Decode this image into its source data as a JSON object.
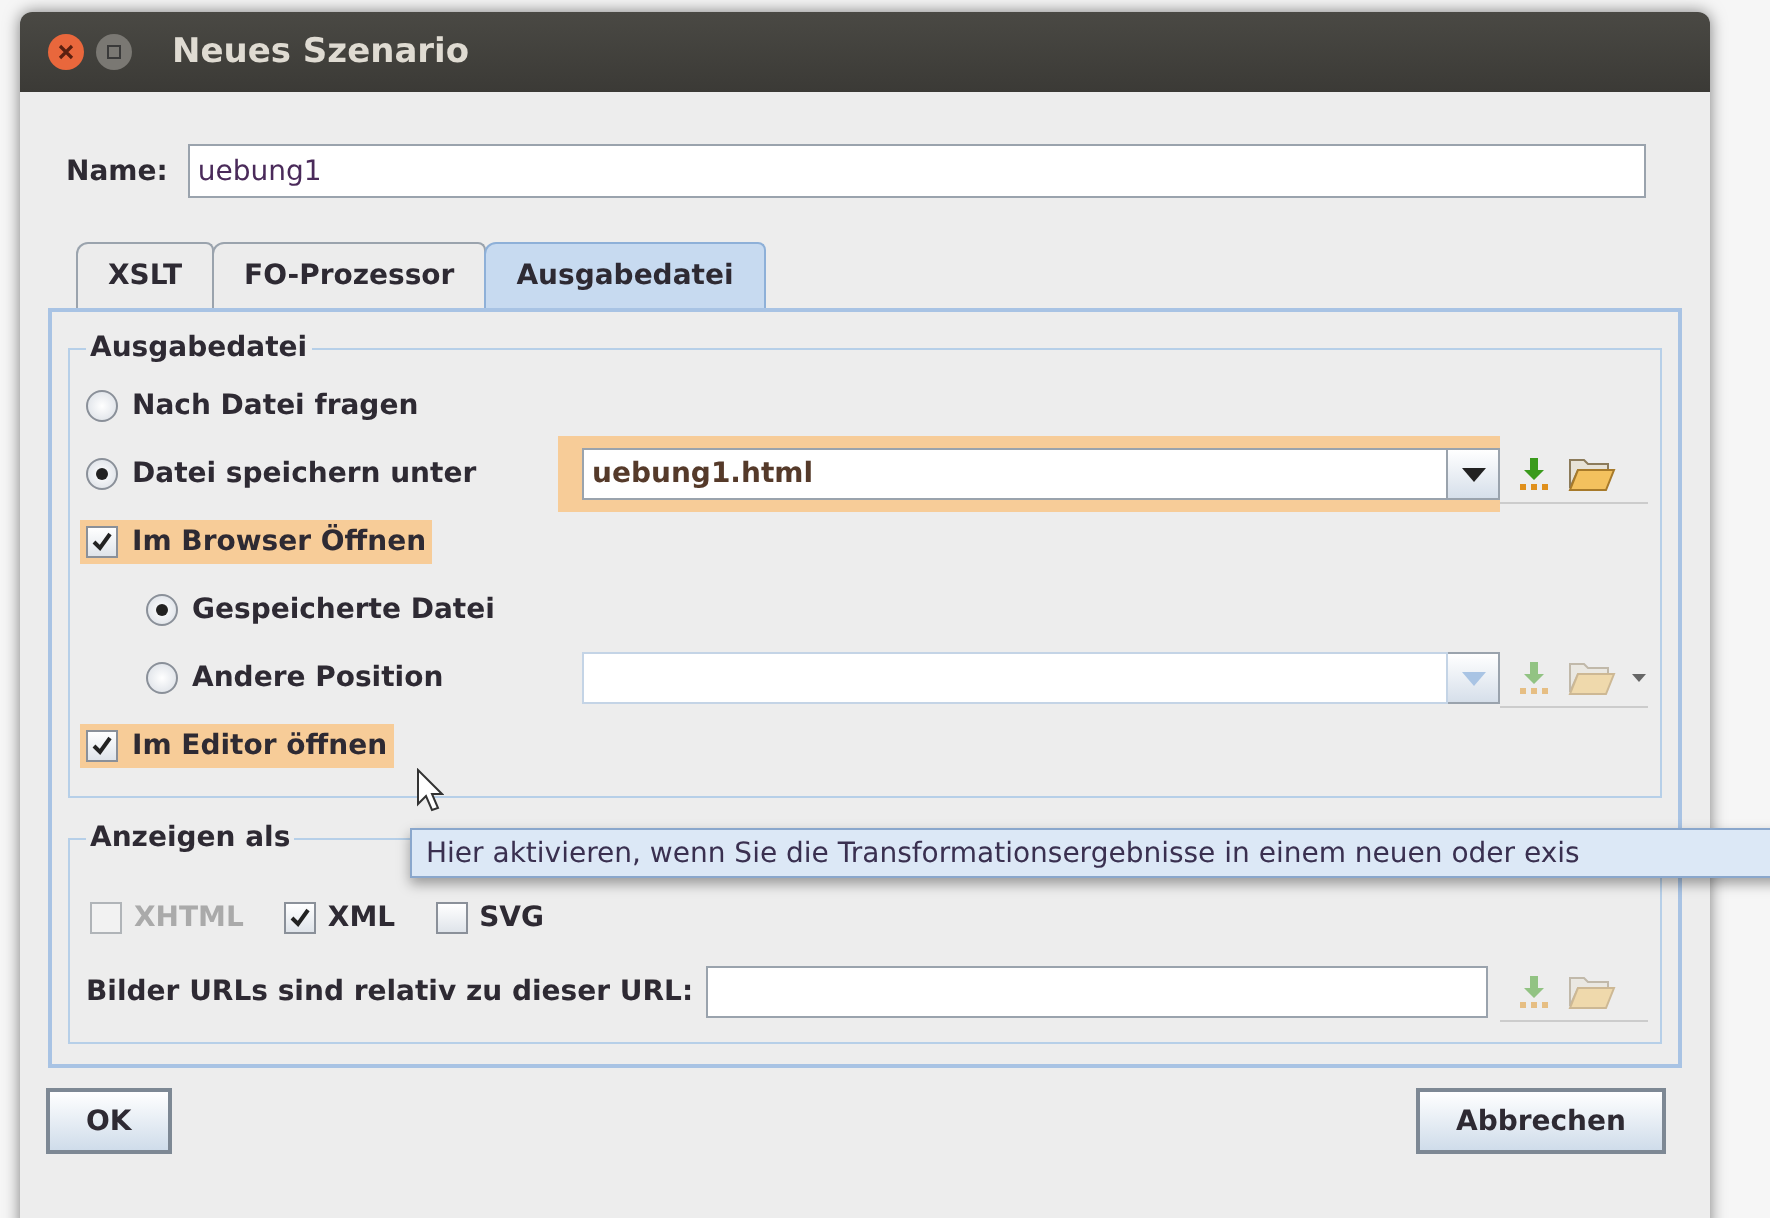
{
  "window": {
    "title": "Neues Szenario"
  },
  "name_field": {
    "label": "Name:",
    "value": "uebung1"
  },
  "tabs": [
    {
      "label": "XSLT",
      "selected": false
    },
    {
      "label": "FO-Prozessor",
      "selected": false
    },
    {
      "label": "Ausgabedatei",
      "selected": true
    }
  ],
  "output_group": {
    "title": "Ausgabedatei",
    "rows": [
      {
        "kind": "radio",
        "label": "Nach Datei fragen",
        "selected": false,
        "highlighted": false
      },
      {
        "kind": "radio",
        "label": "Datei speichern unter",
        "selected": true,
        "highlighted": false,
        "combo": {
          "value": "uebung1.html",
          "highlighted": true,
          "disabled": false
        }
      },
      {
        "kind": "checkbox",
        "label": "Im Browser Öffnen",
        "checked": true,
        "highlighted": true,
        "children": [
          {
            "kind": "radio",
            "label": "Gespeicherte Datei",
            "selected": true,
            "highlighted": false
          },
          {
            "kind": "radio",
            "label": "Andere Position",
            "selected": false,
            "highlighted": false,
            "combo": {
              "highlighted": false,
              "disabled": true
            }
          }
        ]
      },
      {
        "kind": "checkbox",
        "label": "Im Editor öffnen",
        "checked": true,
        "highlighted": true
      }
    ]
  },
  "display_group": {
    "title": "Anzeigen als",
    "formats": [
      {
        "label": "XHTML",
        "checked": false,
        "disabled": true
      },
      {
        "label": "XML",
        "checked": true,
        "disabled": false
      },
      {
        "label": "SVG",
        "checked": false,
        "disabled": false
      }
    ],
    "url_label": "Bilder URLs sind relativ zu dieser URL:"
  },
  "tooltip": {
    "text": "Hier aktivieren, wenn Sie die Transformationsergebnisse in einem neuen oder exis"
  },
  "buttons": [
    {
      "label": "OK"
    },
    {
      "label": "Abbrechen"
    }
  ]
}
